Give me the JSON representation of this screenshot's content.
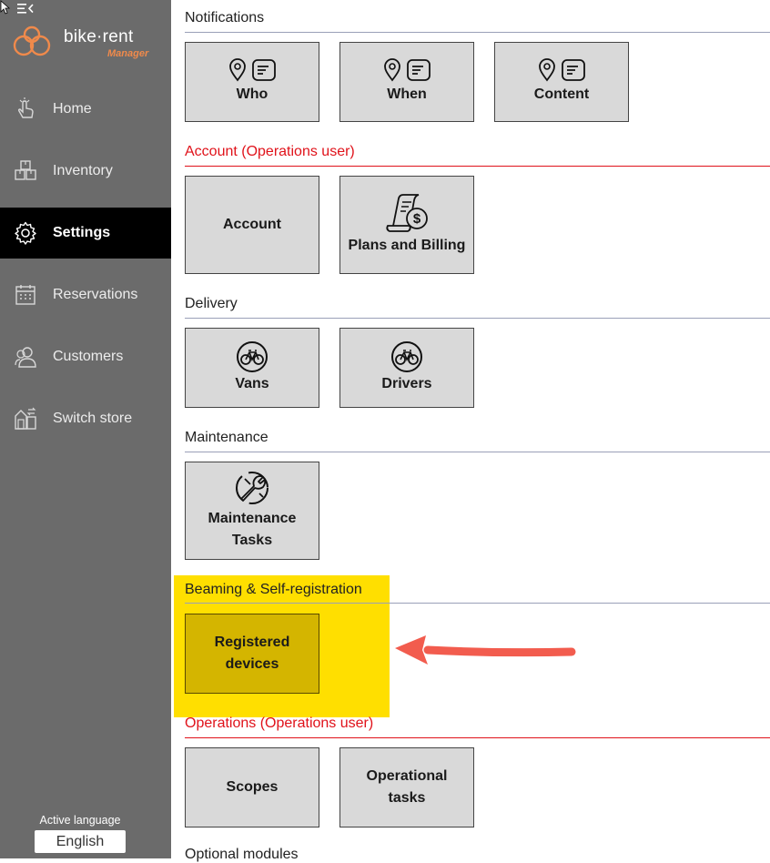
{
  "app": {
    "logo_main": "bike·rent",
    "logo_sub": "Manager"
  },
  "sidebar": {
    "items": [
      {
        "label": "Home",
        "icon": "hand-pointer-icon",
        "active": false
      },
      {
        "label": "Inventory",
        "icon": "boxes-icon",
        "active": false
      },
      {
        "label": "Settings",
        "icon": "gear-icon",
        "active": true
      },
      {
        "label": "Reservations",
        "icon": "calendar-icon",
        "active": false
      },
      {
        "label": "Customers",
        "icon": "users-icon",
        "active": false
      },
      {
        "label": "Switch store",
        "icon": "store-switch-icon",
        "active": false
      }
    ],
    "language_label": "Active language",
    "language_value": "English"
  },
  "sections": {
    "notifications": {
      "title": "Notifications",
      "tiles": [
        {
          "label": "Who"
        },
        {
          "label": "When"
        },
        {
          "label": "Content"
        }
      ]
    },
    "account": {
      "title": "Account (Operations user)",
      "tiles": [
        {
          "label": "Account"
        },
        {
          "label": "Plans and Billing"
        }
      ]
    },
    "delivery": {
      "title": "Delivery",
      "tiles": [
        {
          "label": "Vans"
        },
        {
          "label": "Drivers"
        }
      ]
    },
    "maintenance": {
      "title": "Maintenance",
      "tiles": [
        {
          "label": "Maintenance Tasks"
        }
      ]
    },
    "beaming": {
      "title": "Beaming & Self-registration",
      "tiles": [
        {
          "label": "Registered devices"
        }
      ]
    },
    "operations": {
      "title": "Operations (Operations user)",
      "tiles": [
        {
          "label": "Scopes"
        },
        {
          "label": "Operational tasks"
        }
      ]
    },
    "optional": {
      "title": "Optional modules"
    }
  },
  "colors": {
    "sidebar_bg": "#6b6b6b",
    "active_bg": "#000000",
    "accent_red": "#e0121a",
    "highlight_yellow": "#ffdf00",
    "arrow_red": "#f25c4e",
    "logo_orange": "#f08a4b"
  }
}
